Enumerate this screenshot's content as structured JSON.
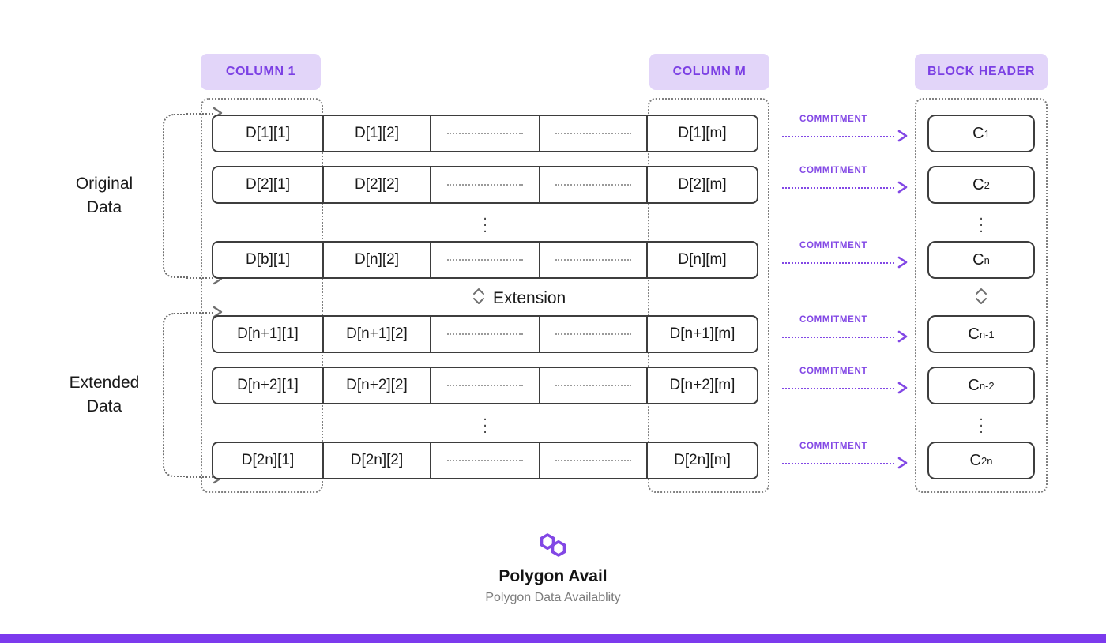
{
  "columns": {
    "col1_label": "COLUMN 1",
    "colm_label": "COLUMN M",
    "header_label": "BLOCK HEADER"
  },
  "brackets": {
    "original": "Original\nData",
    "original_line1": "Original",
    "original_line2": "Data",
    "extended_line1": "Extended",
    "extended_line2": "Data"
  },
  "extension": {
    "label": "Extension",
    "icon": "updown-chevron-icon"
  },
  "grid": {
    "rows": [
      {
        "cells": [
          "D[1][1]",
          "D[1][2]",
          "D[1][m]"
        ]
      },
      {
        "cells": [
          "D[2][1]",
          "D[2][2]",
          "D[2][m]"
        ]
      },
      {
        "cells": [
          "D[b][1]",
          "D[n][2]",
          "D[n][m]"
        ]
      },
      {
        "cells": [
          "D[n+1][1]",
          "D[n+1][2]",
          "D[n+1][m]"
        ]
      },
      {
        "cells": [
          "D[n+2][1]",
          "D[n+2][2]",
          "D[n+2][m]"
        ]
      },
      {
        "cells": [
          "D[2n][1]",
          "D[2n][2]",
          "D[2n][m]"
        ]
      }
    ]
  },
  "commitments": {
    "arrow_label": "COMMITMENT",
    "boxes": [
      {
        "base": "C",
        "sub": "1"
      },
      {
        "base": "C",
        "sub": "2"
      },
      {
        "base": "C",
        "sub": "n"
      },
      {
        "base": "C",
        "sub": "n-1"
      },
      {
        "base": "C",
        "sub": "n-2"
      },
      {
        "base": "C",
        "sub": "2n"
      }
    ]
  },
  "footer": {
    "brand": "Polygon Avail",
    "tagline": "Polygon Data Availablity",
    "logo": "polygon-logo-icon"
  },
  "colors": {
    "accent": "#8247E5",
    "pill_bg": "#E2D5F9",
    "pill_text": "#7B3FE4",
    "bottom_bar": "#7C3AED",
    "stroke": "#3d3d3d"
  }
}
